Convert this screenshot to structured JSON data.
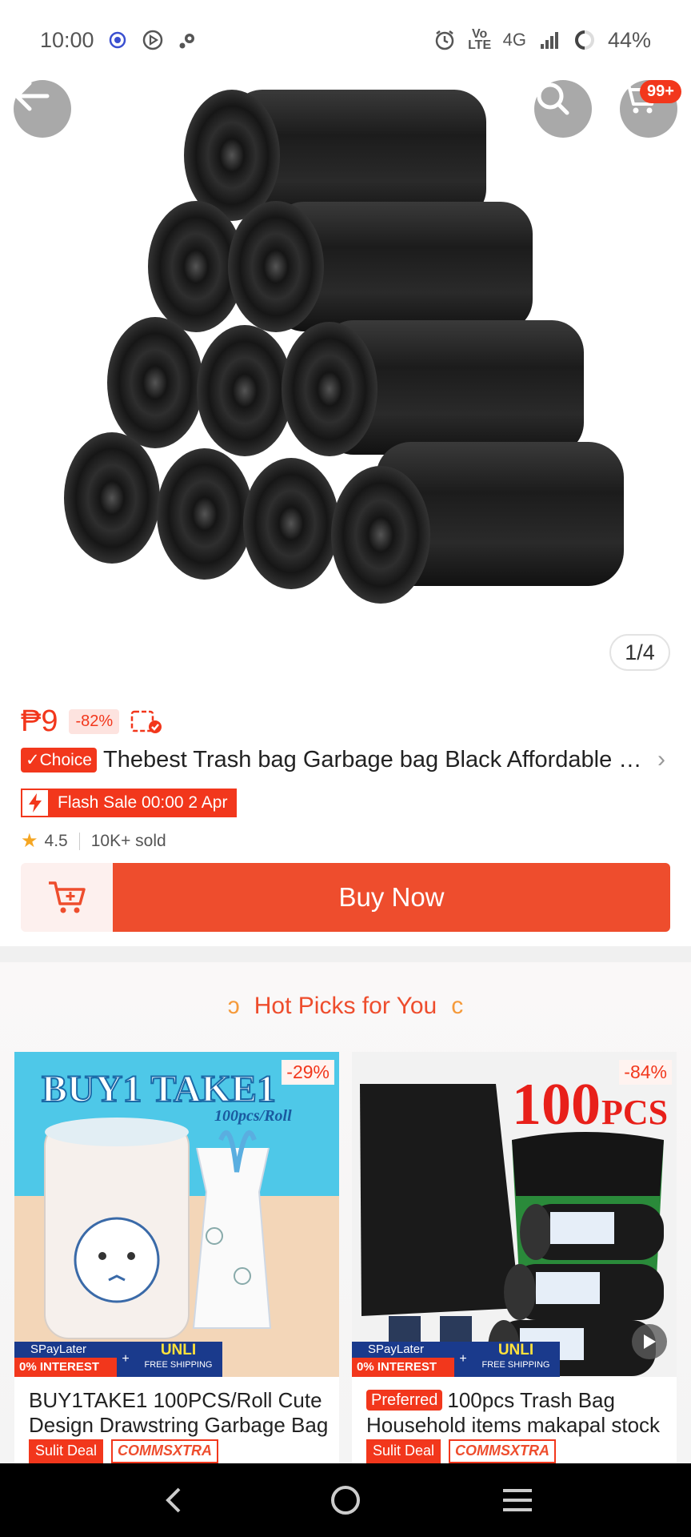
{
  "status_bar": {
    "time": "10:00",
    "network": "4G",
    "battery": "44%"
  },
  "hero": {
    "cart_badge": "99+",
    "page_indicator": "1/4",
    "icons": [
      "back-arrow-icon",
      "search-icon",
      "cart-icon"
    ]
  },
  "product": {
    "price": "₱9",
    "discount": "-82%",
    "choice_label": "Choice",
    "title": "Thebest Trash bag Garbage bag Black Affordable Heavy Duty",
    "flash_sale": "Flash Sale 00:00 2 Apr",
    "rating": "4.5",
    "sold": "10K+ sold",
    "buy_now": "Buy Now"
  },
  "hot_picks": {
    "title": "Hot Picks for You",
    "cards": [
      {
        "discount": "-29%",
        "title": "BUY1TAKE1 100PCS/Roll Cute Design Drawstring Garbage Bag",
        "image_text_1": "BUY1 TAKE1",
        "image_text_2": "100pcs/Roll",
        "paylater_top": "SPayLater",
        "paylater_bottom": "0% INTEREST",
        "unli_top": "UNLI",
        "unli_bottom": "FREE SHIPPING",
        "tag_1": "Sulit Deal",
        "tag_2": "COMMSXTRA"
      },
      {
        "discount": "-84%",
        "preferred": "Preferred",
        "title": "100pcs Trash Bag Household items makapal stock",
        "image_text_1": "100",
        "image_text_2": "PCS",
        "paylater_top": "SPayLater",
        "paylater_bottom": "0% INTEREST",
        "unli_top": "UNLI",
        "unli_bottom": "FREE SHIPPING",
        "tag_1": "Sulit Deal",
        "tag_2": "COMMSXTRA"
      }
    ]
  },
  "colors": {
    "accent": "#ee4d2d",
    "price": "#f2371c",
    "paylater_blue": "#1a3a8c"
  }
}
